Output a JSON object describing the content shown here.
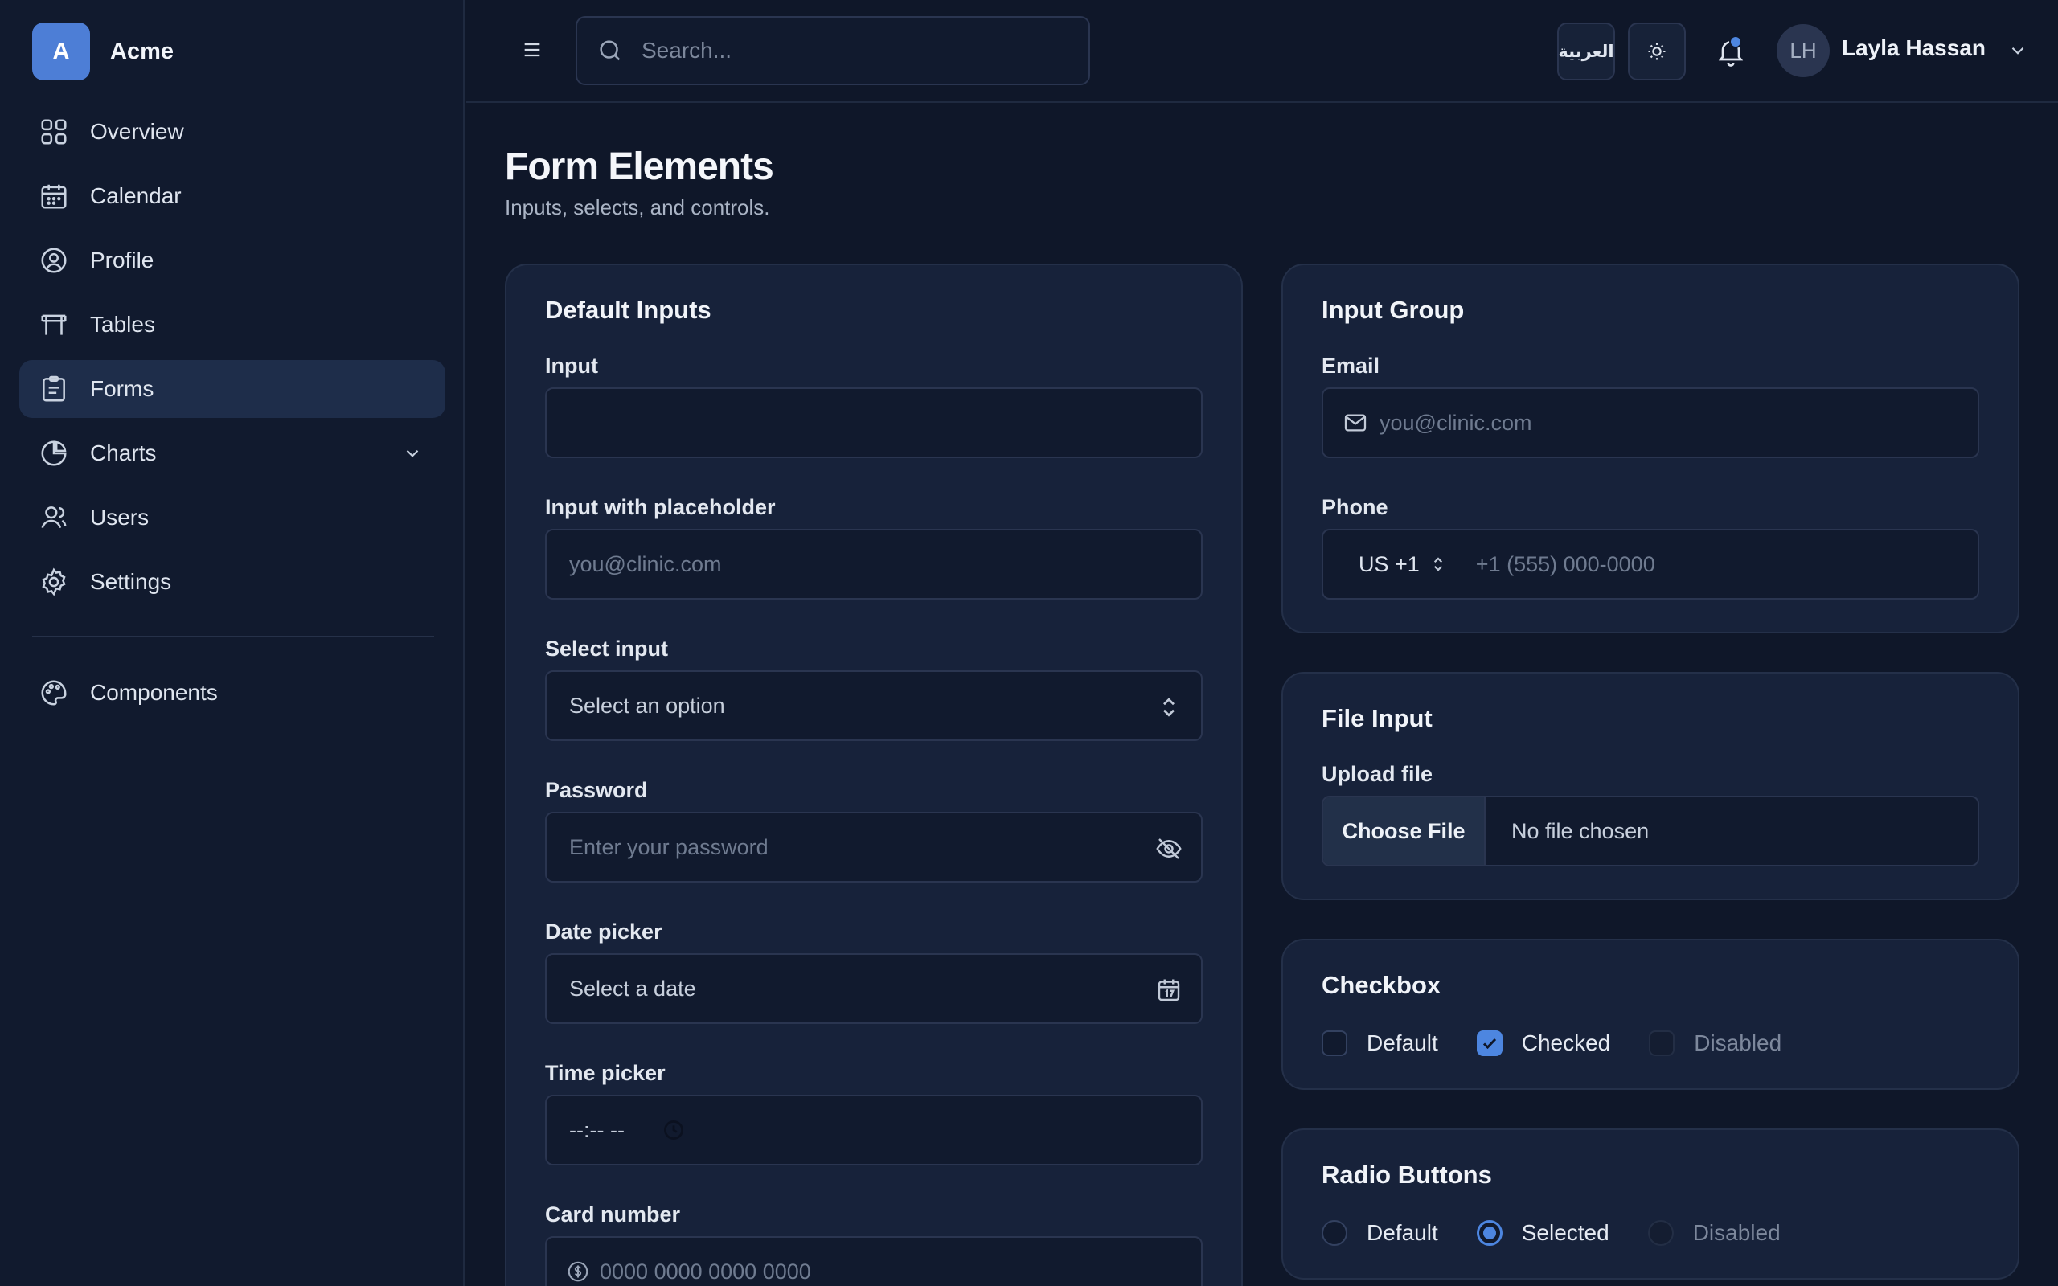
{
  "brand": {
    "logo_letter": "A",
    "name": "Acme"
  },
  "sidebar": {
    "items": [
      {
        "label": "Overview",
        "icon": "grid-icon"
      },
      {
        "label": "Calendar",
        "icon": "calendar-icon"
      },
      {
        "label": "Profile",
        "icon": "user-circle-icon"
      },
      {
        "label": "Tables",
        "icon": "table-icon"
      },
      {
        "label": "Forms",
        "icon": "clipboard-icon",
        "active": true
      },
      {
        "label": "Charts",
        "icon": "pie-chart-icon",
        "expandable": true
      },
      {
        "label": "Users",
        "icon": "users-icon"
      },
      {
        "label": "Settings",
        "icon": "gear-icon"
      }
    ],
    "secondary": [
      {
        "label": "Components",
        "icon": "palette-icon"
      }
    ]
  },
  "header": {
    "search_placeholder": "Search...",
    "language_button": "العربية",
    "user": {
      "initials": "LH",
      "name": "Layla Hassan"
    },
    "accent": "#4d86e0"
  },
  "page": {
    "title": "Form Elements",
    "subtitle": "Inputs, selects, and controls."
  },
  "default_inputs": {
    "title": "Default Inputs",
    "input_label": "Input",
    "input_value": "",
    "placeholder_label": "Input with placeholder",
    "placeholder_text": "you@clinic.com",
    "select_label": "Select input",
    "select_value": "Select an option",
    "password_label": "Password",
    "password_placeholder": "Enter your password",
    "date_label": "Date picker",
    "date_placeholder": "Select a date",
    "time_label": "Time picker",
    "time_value": "--:-- --",
    "card_label": "Card number",
    "card_placeholder": "0000 0000 0000 0000"
  },
  "input_group": {
    "title": "Input Group",
    "email_label": "Email",
    "email_placeholder": "you@clinic.com",
    "phone_label": "Phone",
    "country_code": "US +1",
    "phone_placeholder": "+1 (555) 000-0000"
  },
  "file_input": {
    "title": "File Input",
    "label": "Upload file",
    "button": "Choose File",
    "status": "No file chosen"
  },
  "checkbox": {
    "title": "Checkbox",
    "options": [
      "Default",
      "Checked",
      "Disabled"
    ]
  },
  "radio": {
    "title": "Radio Buttons",
    "options": [
      "Default",
      "Selected",
      "Disabled"
    ]
  }
}
